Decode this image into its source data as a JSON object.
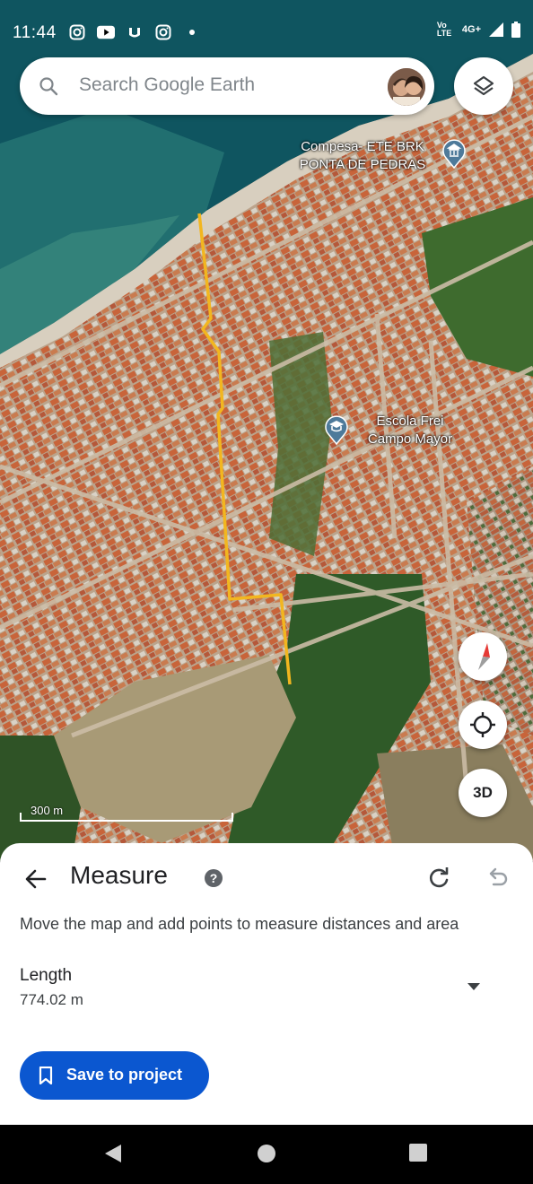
{
  "status_bar": {
    "time": "11:44",
    "icons": [
      "instagram-icon",
      "youtube-icon",
      "mail-icon",
      "instagram-icon",
      "dot-icon"
    ],
    "network": "Vo LTE",
    "signal": "4G+"
  },
  "search": {
    "placeholder": "Search Google Earth"
  },
  "map": {
    "labels": {
      "compesa": "Compesa- ETE BRK\nPONTA DE PEDRAS",
      "escola": "Escola Frei\nCampo Mayor"
    },
    "scale_text": "300 m",
    "fab_3d": "3D",
    "path_color": "#f2b61f"
  },
  "measure": {
    "title": "Measure",
    "help": "?",
    "description": "Move the map and add points to measure distances and area",
    "length_label": "Length",
    "length_value": "774.02 m",
    "save_label": "Save to project"
  },
  "colors": {
    "accent": "#0b57d0",
    "compass_red": "#e53935"
  }
}
